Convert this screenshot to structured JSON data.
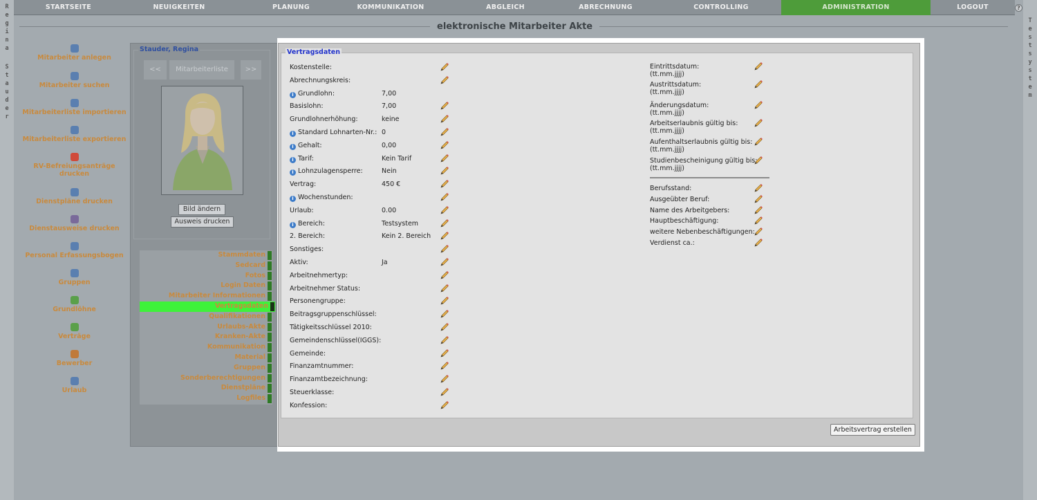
{
  "nav": {
    "items": [
      "STARTSEITE",
      "NEUIGKEITEN",
      "PLANUNG",
      "KOMMUNIKATION",
      "ABGLEICH",
      "ABRECHNUNG",
      "CONTROLLING",
      "ADMINISTRATION",
      "LOGOUT"
    ],
    "active": "ADMINISTRATION",
    "help_icon": "?"
  },
  "left_strip": [
    "R",
    "e",
    "g",
    "i",
    "n",
    "a",
    "S",
    "t",
    "a",
    "u",
    "d",
    "e",
    "r"
  ],
  "right_strip": [
    "T",
    "e",
    "s",
    "t",
    "s",
    "y",
    "s",
    "t",
    "e",
    "m"
  ],
  "page_title": "elektronische Mitarbeiter Akte",
  "left_menu": [
    "Mitarbeiter anlegen",
    "Mitarbeiter suchen",
    "Mitarbeiterliste importieren",
    "Mitarbeiterliste exportieren",
    "RV-Befreiungsanträge drucken",
    "Dienstpläne drucken",
    "Dienstausweise drucken",
    "Personal Erfassungsbogen",
    "Gruppen",
    "Grundlöhne",
    "Verträge",
    "Bewerber",
    "Urlaub"
  ],
  "employee": {
    "name": "Stauder, Regina",
    "prev": "<<",
    "list": "Mitarbeiterliste",
    "next": ">>",
    "change_photo": "Bild ändern",
    "print_id": "Ausweis drucken"
  },
  "subnav": {
    "items": [
      "Stammdaten",
      "Sedcard",
      "Fotos",
      "Login Daten",
      "Mitarbeiter Informationen",
      "Vertragsdaten",
      "Qualifikationen",
      "Urlaubs-Akte",
      "Kranken-Akte",
      "Kommunikation",
      "Material",
      "Gruppen",
      "Sonderberechtigungen",
      "Dienstpläne",
      "Logfiles"
    ],
    "active": "Vertragsdaten"
  },
  "section_title": "Vertragsdaten",
  "left_fields": [
    {
      "label": "Kostenstelle:",
      "value": "",
      "info": false,
      "edit": true
    },
    {
      "label": "Abrechnungskreis:",
      "value": "",
      "info": false,
      "edit": true
    },
    {
      "label": "Grundlohn:",
      "value": "7,00",
      "info": true,
      "edit": false
    },
    {
      "label": "Basislohn:",
      "value": "7,00",
      "info": false,
      "edit": true
    },
    {
      "label": "Grundlohnerhöhung:",
      "value": "keine",
      "info": false,
      "edit": true
    },
    {
      "label": "Standard Lohnarten-Nr.:",
      "value": "0",
      "info": true,
      "edit": true
    },
    {
      "label": "Gehalt:",
      "value": "0,00",
      "info": true,
      "edit": true
    },
    {
      "label": "Tarif:",
      "value": "Kein Tarif",
      "info": true,
      "edit": true
    },
    {
      "label": "Lohnzulagensperre:",
      "value": "Nein",
      "info": true,
      "edit": true
    },
    {
      "label": "Vertrag:",
      "value": "450 €",
      "info": false,
      "edit": true
    },
    {
      "label": "Wochenstunden:",
      "value": "",
      "info": true,
      "edit": true
    },
    {
      "label": "Urlaub:",
      "value": "0.00",
      "info": false,
      "edit": true
    },
    {
      "label": "Bereich:",
      "value": "Testsystem",
      "info": true,
      "edit": true
    },
    {
      "label": "2. Bereich:",
      "value": "Kein 2. Bereich",
      "info": false,
      "edit": true
    },
    {
      "label": "Sonstiges:",
      "value": "",
      "info": false,
      "edit": true
    },
    {
      "label": "Aktiv:",
      "value": "Ja",
      "info": false,
      "edit": true
    },
    {
      "label": "Arbeitnehmertyp:",
      "value": "",
      "info": false,
      "edit": true
    },
    {
      "label": "Arbeitnehmer Status:",
      "value": "",
      "info": false,
      "edit": true
    },
    {
      "label": "Personengruppe:",
      "value": "",
      "info": false,
      "edit": true
    },
    {
      "label": "Beitragsgruppenschlüssel:",
      "value": "",
      "info": false,
      "edit": true
    },
    {
      "label": "Tätigkeitsschlüssel 2010:",
      "value": "",
      "info": false,
      "edit": true
    },
    {
      "label": "Gemeindenschlüssel(IGGS):",
      "value": "",
      "info": false,
      "edit": true
    },
    {
      "label": "Gemeinde:",
      "value": "",
      "info": false,
      "edit": true
    },
    {
      "label": "Finanzamtnummer:",
      "value": "",
      "info": false,
      "edit": true
    },
    {
      "label": "Finanzamtbezeichnung:",
      "value": "",
      "info": false,
      "edit": true
    },
    {
      "label": "Steuerklasse:",
      "value": "",
      "info": false,
      "edit": true
    },
    {
      "label": "Konfession:",
      "value": "",
      "info": false,
      "edit": true
    }
  ],
  "right_date_fields": [
    {
      "label": "Eintrittsdatum:",
      "hint": "(tt.mm.jjjj)"
    },
    {
      "label": "Austrittsdatum:",
      "hint": "(tt.mm.jjjj)"
    },
    {
      "label": "Änderungsdatum:",
      "hint": "(tt.mm.jjjj)"
    },
    {
      "label": "Arbeitserlaubnis gültig bis:",
      "hint": "(tt.mm.jjjj)"
    },
    {
      "label": "Aufenthaltserlaubnis gültig bis:",
      "hint": "(tt.mm.jjjj)"
    },
    {
      "label": "Studienbescheinigung gültig bis:",
      "hint": "(tt.mm.jjjj)"
    }
  ],
  "right_fields": [
    "Berufsstand:",
    "Ausgeübter Beruf:",
    "Name des Arbeitgebers:",
    "Hauptbeschäftigung:",
    "weitere Nebenbeschäftigungen:",
    "Verdienst ca.:"
  ],
  "create_contract_button": "Arbeitsvertrag erstellen",
  "colors": {
    "active_nav": "#4e9c3a",
    "active_subnav": "#3ef23a",
    "menu_text": "#c98a3d",
    "legend": "#2233cc"
  }
}
